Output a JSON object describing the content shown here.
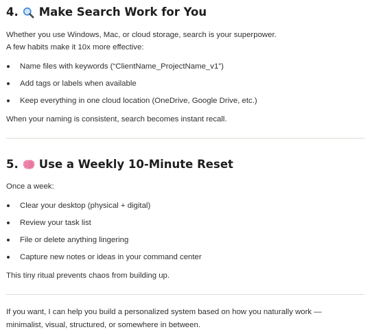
{
  "section4": {
    "number": "4.",
    "icon": "magnifying-glass-emoji",
    "title": "Make Search Work for You",
    "intro_line1": "Whether you use Windows, Mac, or cloud storage, search is your superpower.",
    "intro_line2": "A few habits make it 10x more effective:",
    "bullets": [
      "Name files with keywords (“ClientName_ProjectName_v1”)",
      "Add tags or labels when available",
      "Keep everything in one cloud location (OneDrive, Google Drive, etc.)"
    ],
    "outro": "When your naming is consistent, search becomes instant recall."
  },
  "section5": {
    "number": "5.",
    "icon": "brain-emoji",
    "title": "Use a Weekly 10-Minute Reset",
    "intro": "Once a week:",
    "bullets": [
      "Clear your desktop (physical + digital)",
      "Review your task list",
      "File or delete anything lingering",
      "Capture new notes or ideas in your command center"
    ],
    "outro": "This tiny ritual prevents chaos from building up."
  },
  "closing": {
    "line1": "If you want, I can help you build a personalized system based on how you naturally work —",
    "line2": "minimalist, visual, structured, or somewhere in between."
  },
  "colors": {
    "text": "#2f2f2f",
    "heading": "#1e1e1e",
    "divider": "#e3dcd5",
    "brain": "#ef7fa6",
    "magnifier": "#4a90d9"
  }
}
